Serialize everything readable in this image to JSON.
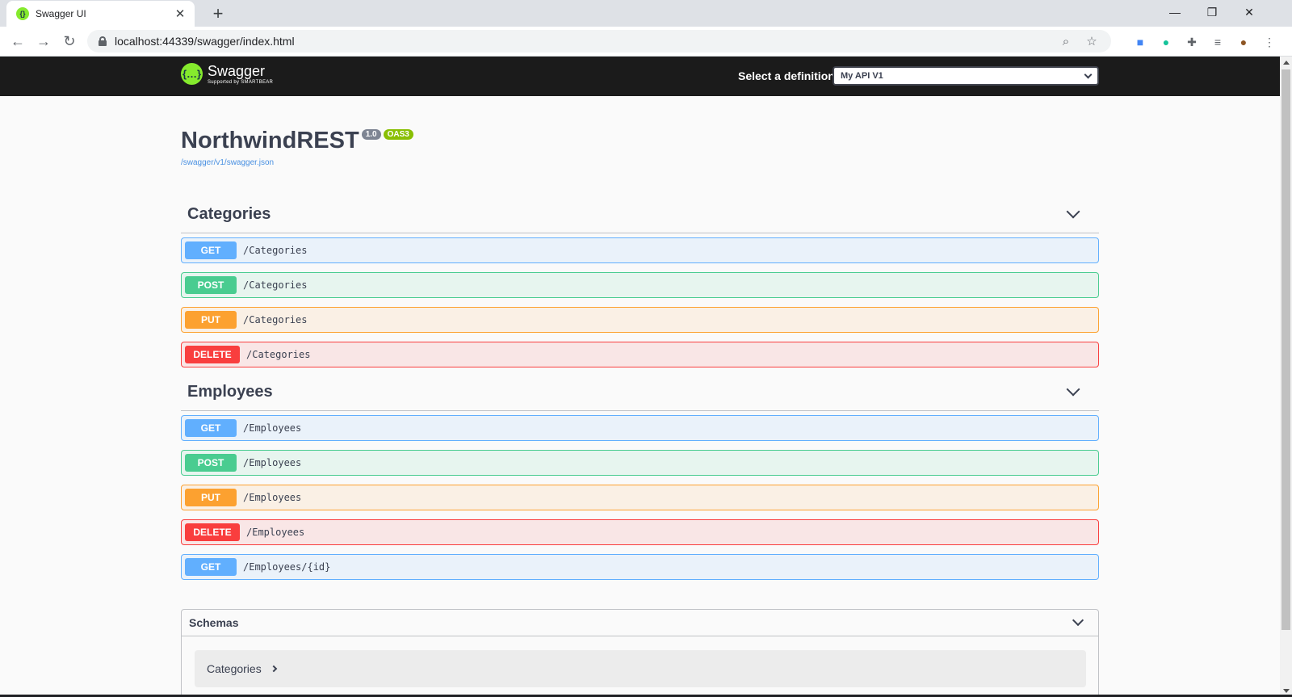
{
  "browser": {
    "tab_title": "Swagger UI",
    "url": "localhost:44339/swagger/index.html"
  },
  "topbar": {
    "logo_name": "Swagger",
    "logo_sub": "Supported by SMARTBEAR",
    "definition_label": "Select a definition",
    "definition_value": "My API V1"
  },
  "info": {
    "title": "NorthwindREST",
    "version": "1.0",
    "oas": "OAS3",
    "spec_url": "/swagger/v1/swagger.json"
  },
  "tags": [
    {
      "name": "Categories",
      "operations": [
        {
          "method": "GET",
          "path": "/Categories"
        },
        {
          "method": "POST",
          "path": "/Categories"
        },
        {
          "method": "PUT",
          "path": "/Categories"
        },
        {
          "method": "DELETE",
          "path": "/Categories"
        }
      ]
    },
    {
      "name": "Employees",
      "operations": [
        {
          "method": "GET",
          "path": "/Employees"
        },
        {
          "method": "POST",
          "path": "/Employees"
        },
        {
          "method": "PUT",
          "path": "/Employees"
        },
        {
          "method": "DELETE",
          "path": "/Employees"
        },
        {
          "method": "GET",
          "path": "/Employees/{id}"
        }
      ]
    }
  ],
  "schemas": {
    "title": "Schemas",
    "models": [
      "Categories"
    ]
  },
  "colors": {
    "get": "#61affe",
    "post": "#49cc90",
    "put": "#fca130",
    "delete": "#f93e3e",
    "swagger_green": "#85ea2d"
  }
}
